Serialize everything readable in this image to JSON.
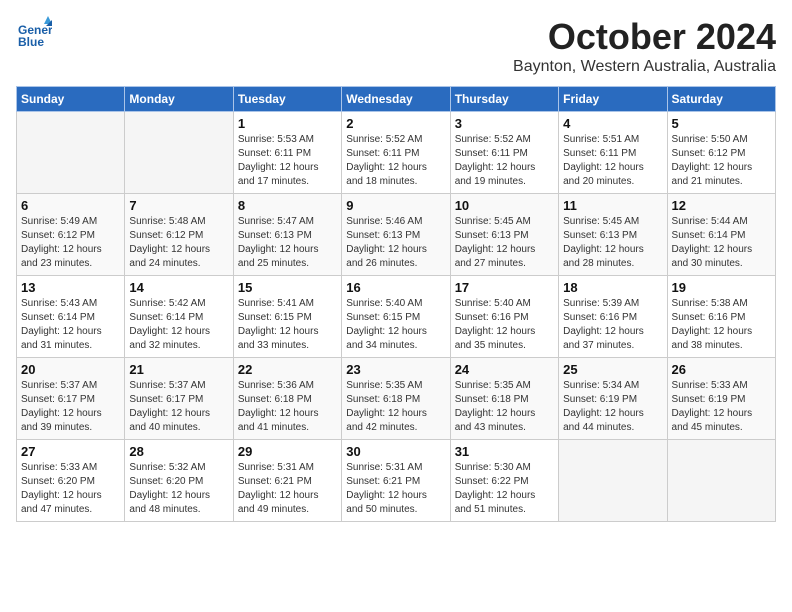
{
  "header": {
    "logo_text_general": "General",
    "logo_text_blue": "Blue",
    "month": "October 2024",
    "location": "Baynton, Western Australia, Australia"
  },
  "weekdays": [
    "Sunday",
    "Monday",
    "Tuesday",
    "Wednesday",
    "Thursday",
    "Friday",
    "Saturday"
  ],
  "weeks": [
    [
      {
        "day": "",
        "empty": true
      },
      {
        "day": "",
        "empty": true
      },
      {
        "day": "1",
        "sunrise": "Sunrise: 5:53 AM",
        "sunset": "Sunset: 6:11 PM",
        "daylight": "Daylight: 12 hours and 17 minutes."
      },
      {
        "day": "2",
        "sunrise": "Sunrise: 5:52 AM",
        "sunset": "Sunset: 6:11 PM",
        "daylight": "Daylight: 12 hours and 18 minutes."
      },
      {
        "day": "3",
        "sunrise": "Sunrise: 5:52 AM",
        "sunset": "Sunset: 6:11 PM",
        "daylight": "Daylight: 12 hours and 19 minutes."
      },
      {
        "day": "4",
        "sunrise": "Sunrise: 5:51 AM",
        "sunset": "Sunset: 6:11 PM",
        "daylight": "Daylight: 12 hours and 20 minutes."
      },
      {
        "day": "5",
        "sunrise": "Sunrise: 5:50 AM",
        "sunset": "Sunset: 6:12 PM",
        "daylight": "Daylight: 12 hours and 21 minutes."
      }
    ],
    [
      {
        "day": "6",
        "sunrise": "Sunrise: 5:49 AM",
        "sunset": "Sunset: 6:12 PM",
        "daylight": "Daylight: 12 hours and 23 minutes."
      },
      {
        "day": "7",
        "sunrise": "Sunrise: 5:48 AM",
        "sunset": "Sunset: 6:12 PM",
        "daylight": "Daylight: 12 hours and 24 minutes."
      },
      {
        "day": "8",
        "sunrise": "Sunrise: 5:47 AM",
        "sunset": "Sunset: 6:13 PM",
        "daylight": "Daylight: 12 hours and 25 minutes."
      },
      {
        "day": "9",
        "sunrise": "Sunrise: 5:46 AM",
        "sunset": "Sunset: 6:13 PM",
        "daylight": "Daylight: 12 hours and 26 minutes."
      },
      {
        "day": "10",
        "sunrise": "Sunrise: 5:45 AM",
        "sunset": "Sunset: 6:13 PM",
        "daylight": "Daylight: 12 hours and 27 minutes."
      },
      {
        "day": "11",
        "sunrise": "Sunrise: 5:45 AM",
        "sunset": "Sunset: 6:13 PM",
        "daylight": "Daylight: 12 hours and 28 minutes."
      },
      {
        "day": "12",
        "sunrise": "Sunrise: 5:44 AM",
        "sunset": "Sunset: 6:14 PM",
        "daylight": "Daylight: 12 hours and 30 minutes."
      }
    ],
    [
      {
        "day": "13",
        "sunrise": "Sunrise: 5:43 AM",
        "sunset": "Sunset: 6:14 PM",
        "daylight": "Daylight: 12 hours and 31 minutes."
      },
      {
        "day": "14",
        "sunrise": "Sunrise: 5:42 AM",
        "sunset": "Sunset: 6:14 PM",
        "daylight": "Daylight: 12 hours and 32 minutes."
      },
      {
        "day": "15",
        "sunrise": "Sunrise: 5:41 AM",
        "sunset": "Sunset: 6:15 PM",
        "daylight": "Daylight: 12 hours and 33 minutes."
      },
      {
        "day": "16",
        "sunrise": "Sunrise: 5:40 AM",
        "sunset": "Sunset: 6:15 PM",
        "daylight": "Daylight: 12 hours and 34 minutes."
      },
      {
        "day": "17",
        "sunrise": "Sunrise: 5:40 AM",
        "sunset": "Sunset: 6:16 PM",
        "daylight": "Daylight: 12 hours and 35 minutes."
      },
      {
        "day": "18",
        "sunrise": "Sunrise: 5:39 AM",
        "sunset": "Sunset: 6:16 PM",
        "daylight": "Daylight: 12 hours and 37 minutes."
      },
      {
        "day": "19",
        "sunrise": "Sunrise: 5:38 AM",
        "sunset": "Sunset: 6:16 PM",
        "daylight": "Daylight: 12 hours and 38 minutes."
      }
    ],
    [
      {
        "day": "20",
        "sunrise": "Sunrise: 5:37 AM",
        "sunset": "Sunset: 6:17 PM",
        "daylight": "Daylight: 12 hours and 39 minutes."
      },
      {
        "day": "21",
        "sunrise": "Sunrise: 5:37 AM",
        "sunset": "Sunset: 6:17 PM",
        "daylight": "Daylight: 12 hours and 40 minutes."
      },
      {
        "day": "22",
        "sunrise": "Sunrise: 5:36 AM",
        "sunset": "Sunset: 6:18 PM",
        "daylight": "Daylight: 12 hours and 41 minutes."
      },
      {
        "day": "23",
        "sunrise": "Sunrise: 5:35 AM",
        "sunset": "Sunset: 6:18 PM",
        "daylight": "Daylight: 12 hours and 42 minutes."
      },
      {
        "day": "24",
        "sunrise": "Sunrise: 5:35 AM",
        "sunset": "Sunset: 6:18 PM",
        "daylight": "Daylight: 12 hours and 43 minutes."
      },
      {
        "day": "25",
        "sunrise": "Sunrise: 5:34 AM",
        "sunset": "Sunset: 6:19 PM",
        "daylight": "Daylight: 12 hours and 44 minutes."
      },
      {
        "day": "26",
        "sunrise": "Sunrise: 5:33 AM",
        "sunset": "Sunset: 6:19 PM",
        "daylight": "Daylight: 12 hours and 45 minutes."
      }
    ],
    [
      {
        "day": "27",
        "sunrise": "Sunrise: 5:33 AM",
        "sunset": "Sunset: 6:20 PM",
        "daylight": "Daylight: 12 hours and 47 minutes."
      },
      {
        "day": "28",
        "sunrise": "Sunrise: 5:32 AM",
        "sunset": "Sunset: 6:20 PM",
        "daylight": "Daylight: 12 hours and 48 minutes."
      },
      {
        "day": "29",
        "sunrise": "Sunrise: 5:31 AM",
        "sunset": "Sunset: 6:21 PM",
        "daylight": "Daylight: 12 hours and 49 minutes."
      },
      {
        "day": "30",
        "sunrise": "Sunrise: 5:31 AM",
        "sunset": "Sunset: 6:21 PM",
        "daylight": "Daylight: 12 hours and 50 minutes."
      },
      {
        "day": "31",
        "sunrise": "Sunrise: 5:30 AM",
        "sunset": "Sunset: 6:22 PM",
        "daylight": "Daylight: 12 hours and 51 minutes."
      },
      {
        "day": "",
        "empty": true
      },
      {
        "day": "",
        "empty": true
      }
    ]
  ]
}
